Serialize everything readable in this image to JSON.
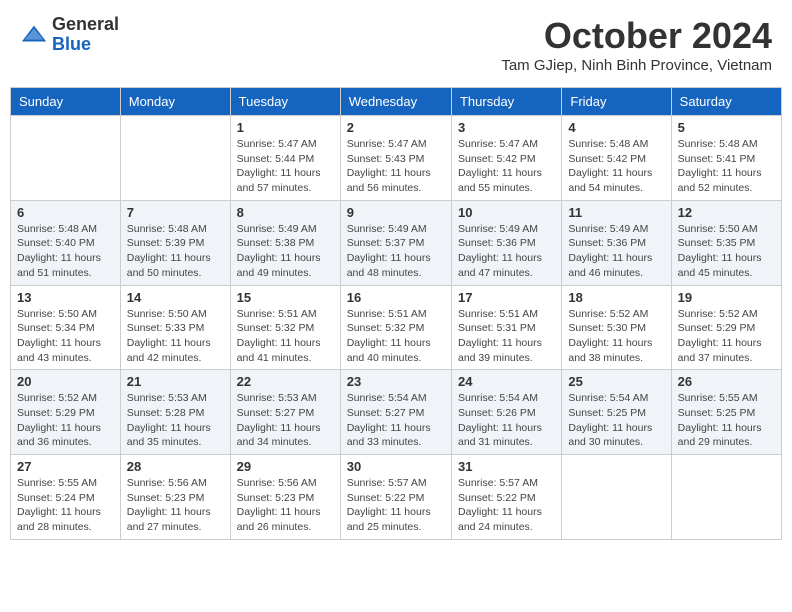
{
  "header": {
    "logo_general": "General",
    "logo_blue": "Blue",
    "month_title": "October 2024",
    "subtitle": "Tam GJiep, Ninh Binh Province, Vietnam"
  },
  "weekdays": [
    "Sunday",
    "Monday",
    "Tuesday",
    "Wednesday",
    "Thursday",
    "Friday",
    "Saturday"
  ],
  "weeks": [
    [
      {
        "day": "",
        "info": ""
      },
      {
        "day": "",
        "info": ""
      },
      {
        "day": "1",
        "info": "Sunrise: 5:47 AM\nSunset: 5:44 PM\nDaylight: 11 hours and 57 minutes."
      },
      {
        "day": "2",
        "info": "Sunrise: 5:47 AM\nSunset: 5:43 PM\nDaylight: 11 hours and 56 minutes."
      },
      {
        "day": "3",
        "info": "Sunrise: 5:47 AM\nSunset: 5:42 PM\nDaylight: 11 hours and 55 minutes."
      },
      {
        "day": "4",
        "info": "Sunrise: 5:48 AM\nSunset: 5:42 PM\nDaylight: 11 hours and 54 minutes."
      },
      {
        "day": "5",
        "info": "Sunrise: 5:48 AM\nSunset: 5:41 PM\nDaylight: 11 hours and 52 minutes."
      }
    ],
    [
      {
        "day": "6",
        "info": "Sunrise: 5:48 AM\nSunset: 5:40 PM\nDaylight: 11 hours and 51 minutes."
      },
      {
        "day": "7",
        "info": "Sunrise: 5:48 AM\nSunset: 5:39 PM\nDaylight: 11 hours and 50 minutes."
      },
      {
        "day": "8",
        "info": "Sunrise: 5:49 AM\nSunset: 5:38 PM\nDaylight: 11 hours and 49 minutes."
      },
      {
        "day": "9",
        "info": "Sunrise: 5:49 AM\nSunset: 5:37 PM\nDaylight: 11 hours and 48 minutes."
      },
      {
        "day": "10",
        "info": "Sunrise: 5:49 AM\nSunset: 5:36 PM\nDaylight: 11 hours and 47 minutes."
      },
      {
        "day": "11",
        "info": "Sunrise: 5:49 AM\nSunset: 5:36 PM\nDaylight: 11 hours and 46 minutes."
      },
      {
        "day": "12",
        "info": "Sunrise: 5:50 AM\nSunset: 5:35 PM\nDaylight: 11 hours and 45 minutes."
      }
    ],
    [
      {
        "day": "13",
        "info": "Sunrise: 5:50 AM\nSunset: 5:34 PM\nDaylight: 11 hours and 43 minutes."
      },
      {
        "day": "14",
        "info": "Sunrise: 5:50 AM\nSunset: 5:33 PM\nDaylight: 11 hours and 42 minutes."
      },
      {
        "day": "15",
        "info": "Sunrise: 5:51 AM\nSunset: 5:32 PM\nDaylight: 11 hours and 41 minutes."
      },
      {
        "day": "16",
        "info": "Sunrise: 5:51 AM\nSunset: 5:32 PM\nDaylight: 11 hours and 40 minutes."
      },
      {
        "day": "17",
        "info": "Sunrise: 5:51 AM\nSunset: 5:31 PM\nDaylight: 11 hours and 39 minutes."
      },
      {
        "day": "18",
        "info": "Sunrise: 5:52 AM\nSunset: 5:30 PM\nDaylight: 11 hours and 38 minutes."
      },
      {
        "day": "19",
        "info": "Sunrise: 5:52 AM\nSunset: 5:29 PM\nDaylight: 11 hours and 37 minutes."
      }
    ],
    [
      {
        "day": "20",
        "info": "Sunrise: 5:52 AM\nSunset: 5:29 PM\nDaylight: 11 hours and 36 minutes."
      },
      {
        "day": "21",
        "info": "Sunrise: 5:53 AM\nSunset: 5:28 PM\nDaylight: 11 hours and 35 minutes."
      },
      {
        "day": "22",
        "info": "Sunrise: 5:53 AM\nSunset: 5:27 PM\nDaylight: 11 hours and 34 minutes."
      },
      {
        "day": "23",
        "info": "Sunrise: 5:54 AM\nSunset: 5:27 PM\nDaylight: 11 hours and 33 minutes."
      },
      {
        "day": "24",
        "info": "Sunrise: 5:54 AM\nSunset: 5:26 PM\nDaylight: 11 hours and 31 minutes."
      },
      {
        "day": "25",
        "info": "Sunrise: 5:54 AM\nSunset: 5:25 PM\nDaylight: 11 hours and 30 minutes."
      },
      {
        "day": "26",
        "info": "Sunrise: 5:55 AM\nSunset: 5:25 PM\nDaylight: 11 hours and 29 minutes."
      }
    ],
    [
      {
        "day": "27",
        "info": "Sunrise: 5:55 AM\nSunset: 5:24 PM\nDaylight: 11 hours and 28 minutes."
      },
      {
        "day": "28",
        "info": "Sunrise: 5:56 AM\nSunset: 5:23 PM\nDaylight: 11 hours and 27 minutes."
      },
      {
        "day": "29",
        "info": "Sunrise: 5:56 AM\nSunset: 5:23 PM\nDaylight: 11 hours and 26 minutes."
      },
      {
        "day": "30",
        "info": "Sunrise: 5:57 AM\nSunset: 5:22 PM\nDaylight: 11 hours and 25 minutes."
      },
      {
        "day": "31",
        "info": "Sunrise: 5:57 AM\nSunset: 5:22 PM\nDaylight: 11 hours and 24 minutes."
      },
      {
        "day": "",
        "info": ""
      },
      {
        "day": "",
        "info": ""
      }
    ]
  ]
}
